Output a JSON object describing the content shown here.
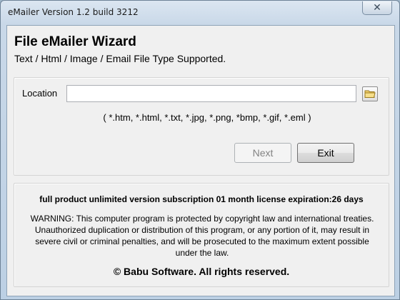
{
  "window": {
    "title": "eMailer Version 1.2 build 3212",
    "close_glyph": "✕"
  },
  "header": {
    "title": "File eMailer  Wizard",
    "subtitle": "Text / Html / Image / Email File Type Supported."
  },
  "location": {
    "label": "Location",
    "value": "",
    "placeholder": "",
    "browse_icon": "folder-icon",
    "extensions_hint": "( *.htm, *.html, *.txt, *.jpg, *.png, *bmp, *.gif, *.eml )"
  },
  "buttons": {
    "next_label": "Next",
    "next_enabled": false,
    "exit_label": "Exit"
  },
  "footer": {
    "license": "full product unlimited version subscription 01 month license expiration:26 days",
    "warning": "WARNING: This computer program is protected by copyright law and international treaties. Unauthorized duplication or distribution of this program, or any portion of it, may result in severe civil or criminal penalties, and will be prosecuted to the maximum extent possible under the law.",
    "copyright": "© Babu Software. All rights reserved."
  },
  "colors": {
    "folder_fill": "#f2d06b",
    "folder_stroke": "#9a7a1f"
  }
}
